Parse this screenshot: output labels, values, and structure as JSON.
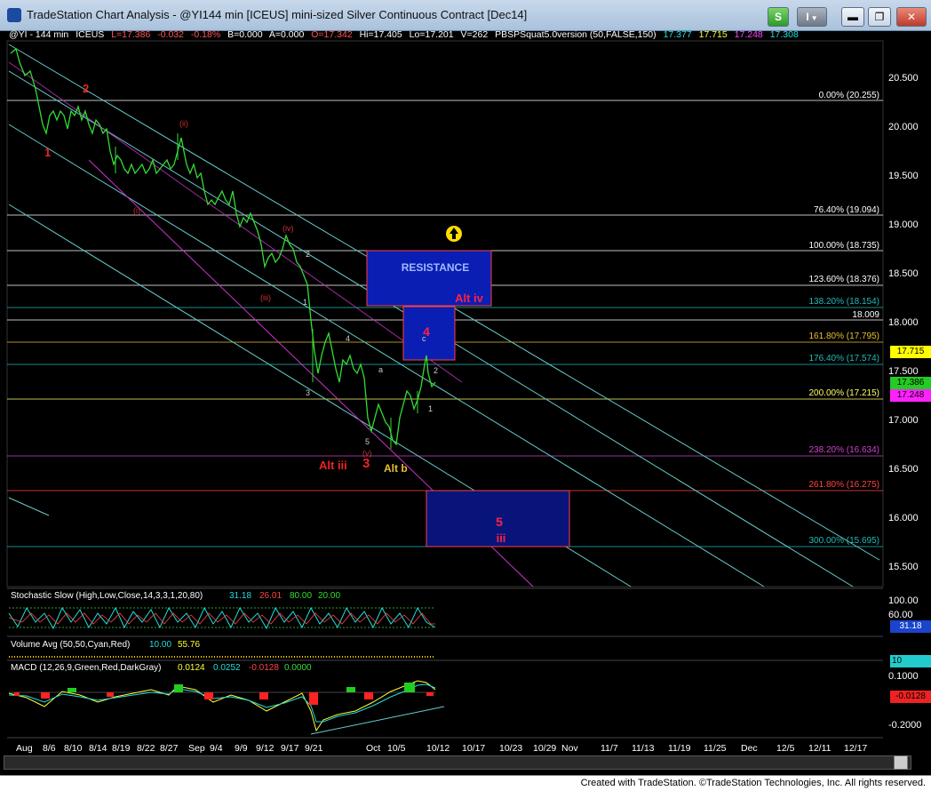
{
  "window": {
    "title": "TradeStation Chart Analysis - @YI144 min [ICEUS] mini-sized Silver Continuous Contract [Dec14]",
    "buttons": {
      "s": "S",
      "i": "I"
    }
  },
  "ticker": {
    "symbol": "@YI - 144 min",
    "exchange": "ICEUS",
    "last": "L=17.386",
    "change": "-0.032",
    "change_pct": "-0.18%",
    "bid": "B=0.000",
    "ask": "A=0.000",
    "open": "O=17.342",
    "high": "Hi=17.405",
    "low": "Lo=17.201",
    "volume": "V=262",
    "indicator": "PBSPSquat5.0version (50,FALSE,150)",
    "v1": "17.377",
    "v2": "17.715",
    "v3": "17.248",
    "v4": "17.308"
  },
  "price_axis": [
    "20.500",
    "20.000",
    "19.500",
    "19.000",
    "18.500",
    "18.000",
    "17.500",
    "17.000",
    "16.500",
    "16.000",
    "15.500"
  ],
  "fib_levels": [
    {
      "label": "0.00% (20.255)",
      "color": "#ffffff"
    },
    {
      "label": "76.40% (19.094)",
      "color": "#ffffff"
    },
    {
      "label": "100.00% (18.735)",
      "color": "#ffffff"
    },
    {
      "label": "123.60% (18.376)",
      "color": "#ffffff"
    },
    {
      "label": "138.20% (18.154)",
      "color": "#22bbbb"
    },
    {
      "label": "161.80% (17.795)",
      "color": "#e8c030"
    },
    {
      "label": "176.40% (17.574)",
      "color": "#22bbbb"
    },
    {
      "label": "200.00% (17.215)",
      "color": "#ffff66"
    },
    {
      "label": "238.20% (16.634)",
      "color": "#cc44cc"
    },
    {
      "label": "261.80% (16.275)",
      "color": "#ff4444"
    },
    {
      "label": "300.00% (15.695)",
      "color": "#22bbbb"
    }
  ],
  "level_18009": "18.009",
  "price_boxes": {
    "p1": "17.715",
    "p2": "17.386",
    "p3": "17.248"
  },
  "annotations": {
    "resistance": "RESISTANCE",
    "alt_iv": "Alt iv",
    "wave_4": "4",
    "wave_c": "c",
    "wave_2": "2",
    "wave_1": "1",
    "alt_iii": "Alt iii",
    "wave_3": "3",
    "alt_b": "Alt b",
    "wave_5": "5",
    "wave_iii": "iii",
    "w1": "1",
    "w2": "2",
    "wi": "(i)",
    "wii": "(ii)",
    "wiii": "(iii)",
    "wiv": "(iv)",
    "wv": "(v)",
    "s2": "2",
    "s1": "1",
    "s4": "4",
    "s3": "3",
    "sa": "a",
    "s5": "5"
  },
  "stochastic": {
    "label": "Stochastic Slow (High,Low,Close,14,3,3,1,20,80)",
    "v1": "31.18",
    "v2": "26.01",
    "v3": "80.00",
    "v4": "20.00",
    "axis": [
      "100.00",
      "60.00"
    ],
    "box": "31.18"
  },
  "volume": {
    "label": "Volume Avg (50,50,Cyan,Red)",
    "v1": "10.00",
    "v2": "55.76",
    "box": "10"
  },
  "macd": {
    "label": "MACD (12,26,9,Green,Red,DarkGray)",
    "v1": "0.0124",
    "v2": "0.0252",
    "v3": "-0.0128",
    "v4": "0.0000",
    "axis": [
      "0.1000",
      "-0.2000"
    ],
    "box": "-0.0128"
  },
  "time_axis": [
    "Aug",
    "8/6",
    "8/10",
    "8/14",
    "8/19",
    "8/22",
    "8/27",
    "Sep",
    "9/4",
    "9/9",
    "9/12",
    "9/17",
    "9/21",
    "Oct",
    "10/5",
    "10/12",
    "10/17",
    "10/23",
    "10/29",
    "Nov",
    "11/7",
    "11/13",
    "11/19",
    "11/25",
    "Dec",
    "12/5",
    "12/11",
    "12/17"
  ],
  "footer": "Created with TradeStation. ©TradeStation Technologies, Inc. All rights reserved.",
  "colors": {
    "price": "#33dd33",
    "resistance_box": "#0a1eb4",
    "target_box": "#08147a",
    "channel": "#66cccc",
    "magenta": "#cc33cc"
  }
}
